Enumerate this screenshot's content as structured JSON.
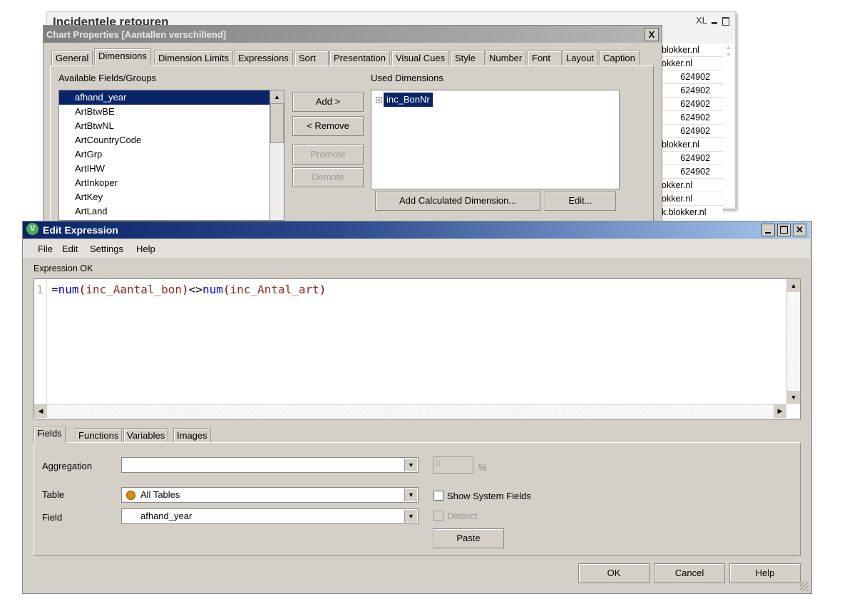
{
  "bg_window": {
    "title": "Incidentele retouren",
    "xl": "XL",
    "rows": [
      "blokker.nl",
      "okker.nl",
      "624902",
      "624902",
      "624902",
      "624902",
      "624902",
      "blokker.nl",
      "624902",
      "624902",
      "okker.nl",
      "okker.nl",
      "k.blokker.nl"
    ]
  },
  "chart_props": {
    "title": "Chart Properties [Aantallen verschillend]",
    "close": "X",
    "tabs": [
      "General",
      "Dimensions",
      "Dimension Limits",
      "Expressions",
      "Sort",
      "Presentation",
      "Visual Cues",
      "Style",
      "Number",
      "Font",
      "Layout",
      "Caption"
    ],
    "available_label": "Available Fields/Groups",
    "used_label": "Used Dimensions",
    "fields": [
      "afhand_year",
      "ArtBtwBE",
      "ArtBtwNL",
      "ArtCountryCode",
      "ArtGrp",
      "ArtIHW",
      "ArtInkoper",
      "ArtKey",
      "ArtLand"
    ],
    "used": [
      "inc_BonNr"
    ],
    "add": "Add >",
    "remove": "< Remove",
    "promote": "Promote",
    "demote": "Demote",
    "add_calc": "Add Calculated Dimension...",
    "edit": "Edit..."
  },
  "edit_expr": {
    "title": "Edit Expression",
    "menu": [
      "File",
      "Edit",
      "Settings",
      "Help"
    ],
    "status": "Expression OK",
    "line_no": "1",
    "expr": {
      "p1": "=",
      "f1": "num",
      "o1": "(",
      "a1": "inc_Aantal_bon",
      "c1": ")",
      "op": "<>",
      "f2": "num",
      "o2": "(",
      "a2": "inc_Antal_art",
      "c2": ")"
    },
    "tabs": [
      "Fields",
      "Functions",
      "Variables",
      "Images"
    ],
    "aggregation_label": "Aggregation",
    "aggregation_value": "",
    "percent_value": "0",
    "percent_sign": "%",
    "table_label": "Table",
    "table_value": "All Tables",
    "field_label": "Field",
    "field_value": "afhand_year",
    "show_system": "Show System Fields",
    "distinct": "Distinct",
    "paste": "Paste",
    "ok": "OK",
    "cancel": "Cancel",
    "help": "Help"
  }
}
